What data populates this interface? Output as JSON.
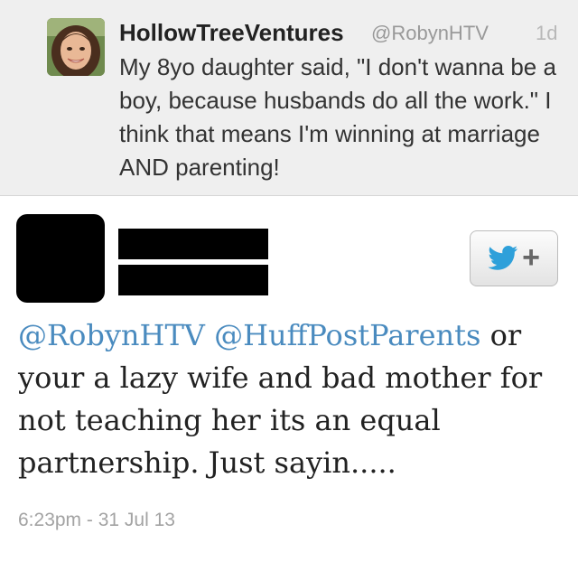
{
  "parent_tweet": {
    "display_name": "HollowTreeVentures",
    "handle": "@RobynHTV",
    "relative_time": "1d",
    "text": "My 8yo daughter said, \"I don't wanna be a boy, because husbands do all the work.\" I think that means I'm winning at marriage AND parenting!"
  },
  "reply_tweet": {
    "mention_1": "@RobynHTV",
    "mention_2": "@HuffPostParents",
    "text_rest": " or your a lazy wife and bad mother for not teaching her its an equal partnership. Just sayin.....",
    "timestamp": "6:23pm - 31 Jul 13"
  },
  "colors": {
    "mention": "#4a8bbf",
    "twitter_bird": "#2ea0da"
  },
  "icons": {
    "follow_button": "twitter-bird-plus-icon"
  }
}
